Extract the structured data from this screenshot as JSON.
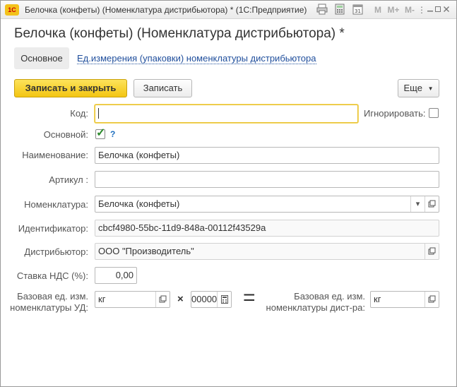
{
  "window": {
    "title": "Белочка (конфеты) (Номенклатура дистрибьютора) * (1С:Предприятие)",
    "app_logo": "1С",
    "toolbar_letters": [
      "M",
      "M+",
      "M-"
    ],
    "icons": [
      "print-icon",
      "calculator-icon",
      "calendar-icon",
      "more-icon",
      "minimize-icon",
      "maximize-icon",
      "close-icon"
    ]
  },
  "form": {
    "title": "Белочка (конфеты) (Номенклатура дистрибьютора) *",
    "tabs": {
      "main": "Основное",
      "link": "Ед.измерения (упаковки)  номенклатуры дистрибьютора"
    },
    "buttons": {
      "save_close": "Записать и закрыть",
      "save": "Записать",
      "more": "Еще"
    },
    "fields": {
      "code_label": "Код:",
      "code_value": "",
      "ignore_label": "Игнорировать:",
      "ignore_checked": false,
      "main_label": "Основной:",
      "main_checked": true,
      "main_help": "?",
      "name_label": "Наименование:",
      "name_value": "Белочка (конфеты)",
      "article_label": "Артикул :",
      "article_value": "",
      "nomenclature_label": "Номенклатура:",
      "nomenclature_value": "Белочка (конфеты)",
      "identifier_label": "Идентификатор:",
      "identifier_value": "cbcf4980-55bc-11d9-848a-00112f43529a",
      "distributor_label": "Дистрибьютор:",
      "distributor_value": "ООО \"Производитель\"",
      "vat_label": "Ставка НДС (%):",
      "vat_value": "0,00",
      "base_unit_label_1": "Базовая ед. изм.",
      "base_unit_label_2": "номенклатуры УД:",
      "base_unit_value": "кг",
      "multiplier_symbol": "×",
      "ratio_value": "00000",
      "equals_symbol": "=",
      "dist_unit_label_1": "Базовая ед. изм.",
      "dist_unit_label_2": "номенклатуры дист-ра:",
      "dist_unit_value": "кг"
    }
  }
}
